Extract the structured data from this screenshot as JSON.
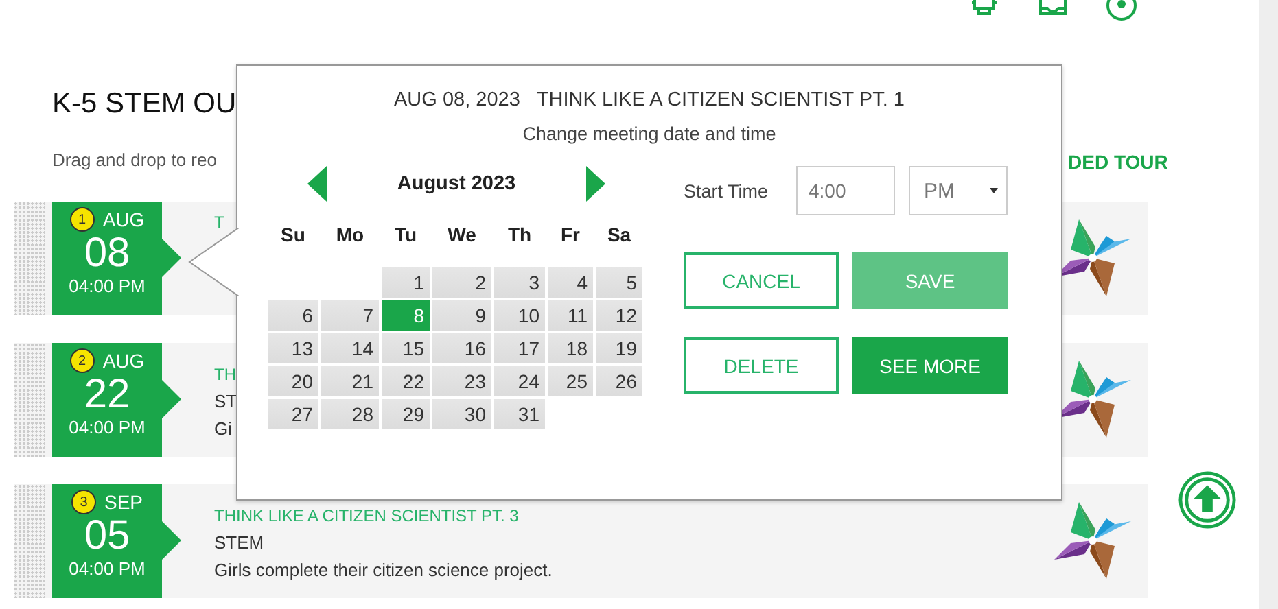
{
  "page": {
    "title": "K-5 STEM OU",
    "instructions": "Drag and drop to reo",
    "tour_link": "DED TOUR"
  },
  "meetings": [
    {
      "number": "1",
      "month": "AUG",
      "day": "08",
      "time": "04:00 PM",
      "title": "T"
    },
    {
      "number": "2",
      "month": "AUG",
      "day": "22",
      "time": "04:00 PM",
      "title": "TH",
      "category": "ST",
      "description": "Gi"
    },
    {
      "number": "3",
      "month": "SEP",
      "day": "05",
      "time": "04:00 PM",
      "title": "THINK LIKE A CITIZEN SCIENTIST PT. 3",
      "category": "STEM",
      "description": "Girls complete their citizen science project."
    }
  ],
  "popup": {
    "date": "AUG 08, 2023",
    "meeting_title": "THINK LIKE A CITIZEN SCIENTIST PT. 1",
    "subtitle": "Change meeting date and time",
    "calendar": {
      "month": "August 2023",
      "weekdays": [
        "Su",
        "Mo",
        "Tu",
        "We",
        "Th",
        "Fr",
        "Sa"
      ],
      "weeks": [
        [
          {
            "kind": "blank"
          },
          {
            "kind": "blank"
          },
          {
            "day": "1",
            "selected": false
          },
          {
            "day": "2",
            "selected": false
          },
          {
            "day": "3",
            "selected": false
          },
          {
            "day": "4",
            "selected": false
          },
          {
            "day": "5",
            "selected": false
          }
        ],
        [
          {
            "day": "6",
            "selected": false
          },
          {
            "day": "7",
            "selected": false
          },
          {
            "day": "8",
            "selected": true
          },
          {
            "day": "9",
            "selected": false
          },
          {
            "day": "10",
            "selected": false
          },
          {
            "day": "11",
            "selected": false
          },
          {
            "day": "12",
            "selected": false
          }
        ],
        [
          {
            "day": "13",
            "selected": false
          },
          {
            "day": "14",
            "selected": false
          },
          {
            "day": "15",
            "selected": false
          },
          {
            "day": "16",
            "selected": false
          },
          {
            "day": "17",
            "selected": false
          },
          {
            "day": "18",
            "selected": false
          },
          {
            "day": "19",
            "selected": false
          }
        ],
        [
          {
            "day": "20",
            "selected": false
          },
          {
            "day": "21",
            "selected": false
          },
          {
            "day": "22",
            "selected": false
          },
          {
            "day": "23",
            "selected": false
          },
          {
            "day": "24",
            "selected": false
          },
          {
            "day": "25",
            "selected": false
          },
          {
            "day": "26",
            "selected": false
          }
        ],
        [
          {
            "day": "27",
            "selected": false
          },
          {
            "day": "28",
            "selected": false
          },
          {
            "day": "29",
            "selected": false
          },
          {
            "day": "30",
            "selected": false
          },
          {
            "day": "31",
            "selected": false
          },
          {
            "kind": "blank"
          },
          {
            "kind": "blank"
          }
        ]
      ]
    },
    "start_time": {
      "label": "Start Time",
      "value": "4:00",
      "period": "PM"
    },
    "buttons": [
      {
        "label": "CANCEL",
        "kind": "outline"
      },
      {
        "label": "SAVE",
        "kind": "light"
      },
      {
        "label": "DELETE",
        "kind": "outline"
      },
      {
        "label": "SEE MORE",
        "kind": "solid"
      }
    ]
  }
}
